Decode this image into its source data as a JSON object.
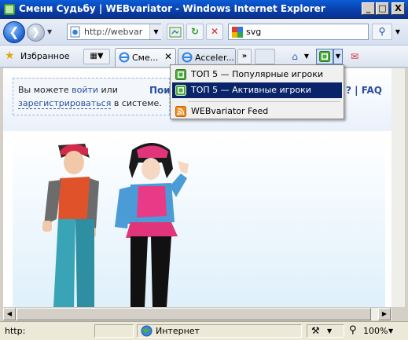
{
  "window": {
    "title": "Смени Судьбу | WEBvariator - Windows Internet Explorer",
    "min_label": "_",
    "max_label": "□",
    "close_label": "X"
  },
  "address_bar": {
    "url": "http://webvar",
    "search_text": "svg"
  },
  "favorites": {
    "label": "Избранное"
  },
  "tabs": [
    {
      "label": "Сме...",
      "active": true
    },
    {
      "label": "Acceler...",
      "active": false
    }
  ],
  "tabs_more_label": "»",
  "page": {
    "login_text_1": "Вы можете ",
    "login_link": "войти",
    "login_text_2": " или",
    "register_link": "зарегистрироваться",
    "register_text": " в системе.",
    "nav_search": "Поис",
    "nav_faq": "? | FAQ"
  },
  "feed_menu": {
    "items": [
      {
        "label": "ТОП 5 — Популярные игроки",
        "icon": "rss-icon-green"
      },
      {
        "label": "ТОП 5 — Активные игроки",
        "icon": "rss-icon-green",
        "selected": true
      },
      {
        "label": "WEBvariator Feed",
        "icon": "rss-icon-orange"
      }
    ]
  },
  "status_bar": {
    "status": "http:",
    "zone": "Интернет",
    "zoom": "100%"
  },
  "colors": {
    "titlebar": "#0a3ea8",
    "menu_highlight": "#0a246a",
    "link": "#2a4fa0"
  }
}
